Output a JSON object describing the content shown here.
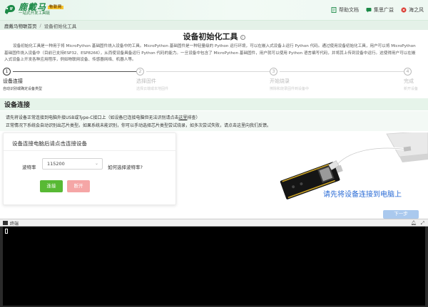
{
  "brand": {
    "name": "鹿戴马",
    "badge": "物联网",
    "slogan": "一站式开发工具链"
  },
  "topnav": [
    {
      "label": "帮助文档",
      "icon": "document-icon"
    },
    {
      "label": "集思广益",
      "icon": "chat-icon"
    },
    {
      "label": "海之风",
      "icon": "user-icon"
    }
  ],
  "breadcrumb": {
    "home": "鹿戴马物联首页",
    "separator": "/",
    "current": "设备初始化工具"
  },
  "page": {
    "title": "设备初始化工具",
    "info_icon": "i",
    "intro": "设备初始化工具是一种用于将 MicroPython 基础固件烧入设备中的工具。MicroPython 基础固件是一种轻量级的 Python 运行环境，可以在嵌入式设备上运行 Python 代码。通过使用设备初始化工具，用户可以将 MicroPython 基础固件烧入设备中（目前已支持ESP32、ESP8266），从而使设备具备运行 Python 代码的能力。一旦设备中包含了 MicroPython 基础固件，用户就可以使用 Python 语言编写代码，并将其上传到设备中运行。这使得用户可以在嵌入式设备上开发各种应用程序，例如物联网设备、传感器网络、机器人等。"
  },
  "steps": [
    {
      "num": "1",
      "title": "设备连接",
      "desc": "自动识别或确定设备类型",
      "active": true
    },
    {
      "num": "2",
      "title": "选择固件",
      "desc": "选择云端或本地固件",
      "active": false
    },
    {
      "num": "3",
      "title": "开始烧录",
      "desc": "擦除和烧录固件到设备中",
      "active": false
    },
    {
      "num": "4",
      "title": "完成",
      "desc": "新开设备",
      "active": false
    }
  ],
  "section": {
    "title": "设备连接",
    "notice_line1_prefix": "请先将设备正常连接到电脑外接USB或Type-C接口上（如设备已连接电脑但无法识别请点击",
    "notice_line1_link": "这里",
    "notice_line1_suffix": "排查）",
    "notice_line2": "正常情况下系统会自动识别出芯片类型。如果系统未能识别，你可以手动选择芯片类型尝试烧录，如多次尝试失败，请点击这里向我们反馈。"
  },
  "connect_card": {
    "title": "设备连接电脑后请点击连接设备",
    "baud_label": "波特率",
    "baud_value": "115200",
    "baud_help": "如何选择波特率?",
    "connect_label": "连接",
    "disconnect_label": "断开"
  },
  "illustration": {
    "caption": "请先将设备连接到电脑上"
  },
  "next_button": "下一步",
  "terminal": {
    "title": "终端"
  },
  "colors": {
    "brand_green": "#1c8a47",
    "connect_green": "#58b934",
    "disconnect_pink": "#f5a6a6",
    "caption_blue": "#2b6cd6",
    "next_blue": "#aac9ee"
  }
}
